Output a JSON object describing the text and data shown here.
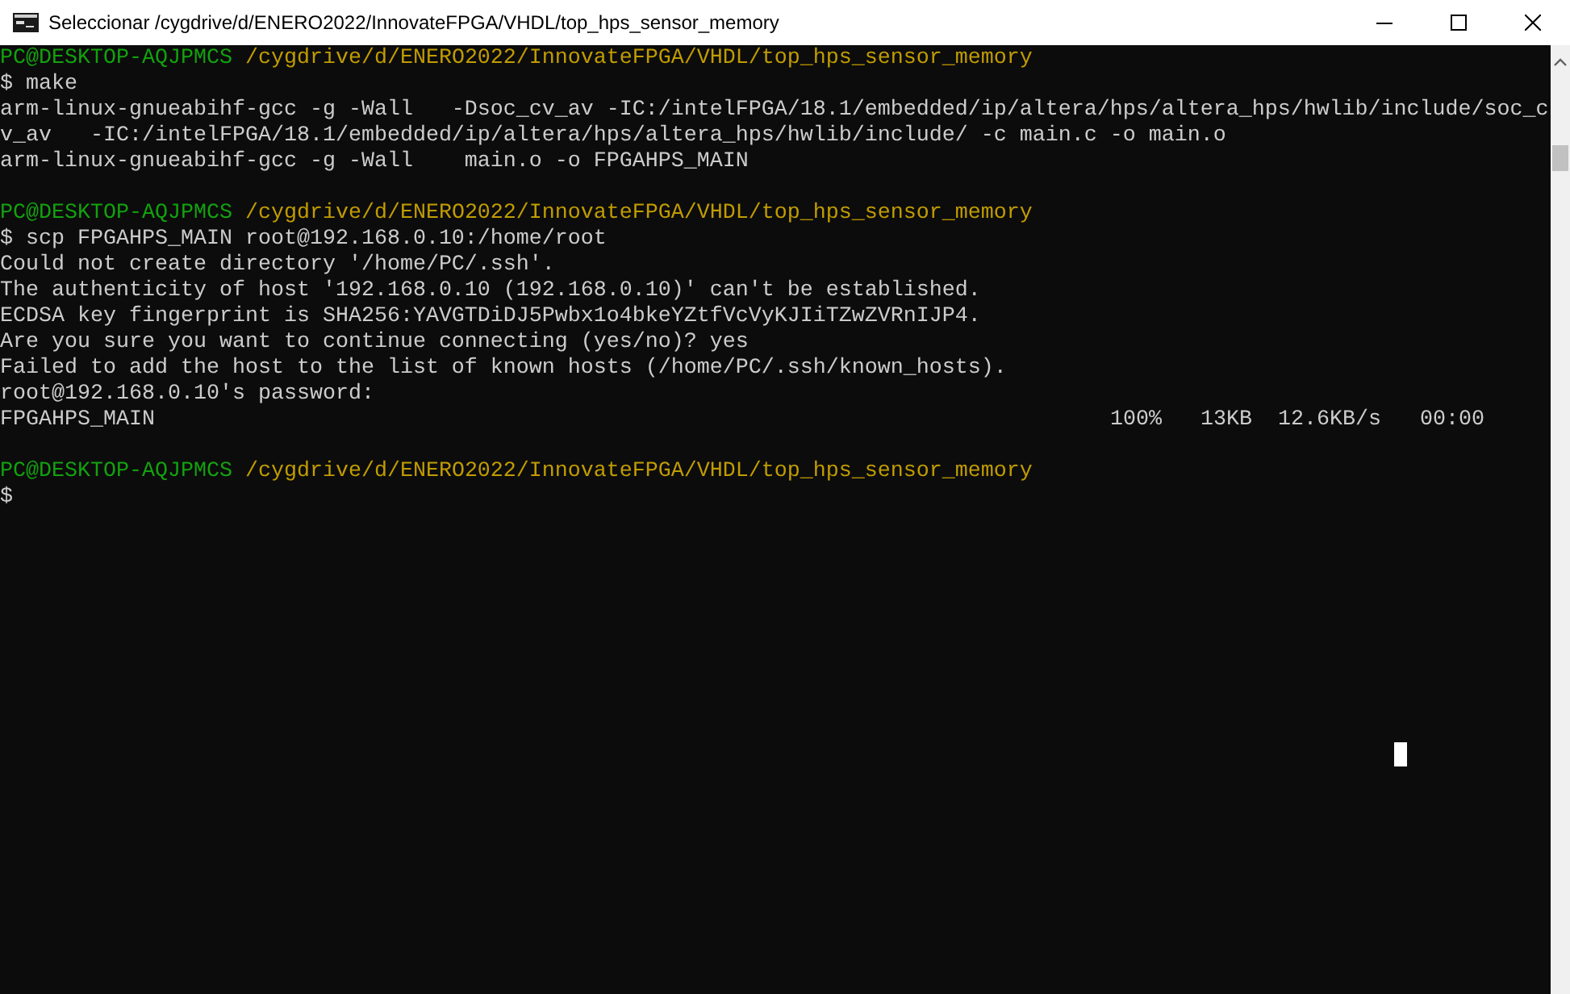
{
  "window": {
    "title": "Seleccionar /cygdrive/d/ENERO2022/InnovateFPGA/VHDL/top_hps_sensor_memory"
  },
  "terminal": {
    "lines": [
      {
        "kind": "prompt",
        "user": "PC@DESKTOP-AQJPMCS",
        "path": "/cygdrive/d/ENERO2022/InnovateFPGA/VHDL/top_hps_sensor_memory"
      },
      {
        "kind": "text",
        "text": "$ make"
      },
      {
        "kind": "text",
        "text": "arm-linux-gnueabihf-gcc -g -Wall   -Dsoc_cv_av -IC:/intelFPGA/18.1/embedded/ip/altera/hps/altera_hps/hwlib/include/soc_c"
      },
      {
        "kind": "text",
        "text": "v_av   -IC:/intelFPGA/18.1/embedded/ip/altera/hps/altera_hps/hwlib/include/ -c main.c -o main.o"
      },
      {
        "kind": "text",
        "text": "arm-linux-gnueabihf-gcc -g -Wall    main.o -o FPGAHPS_MAIN"
      },
      {
        "kind": "blank"
      },
      {
        "kind": "prompt",
        "user": "PC@DESKTOP-AQJPMCS",
        "path": "/cygdrive/d/ENERO2022/InnovateFPGA/VHDL/top_hps_sensor_memory"
      },
      {
        "kind": "text",
        "text": "$ scp FPGAHPS_MAIN root@192.168.0.10:/home/root"
      },
      {
        "kind": "text",
        "text": "Could not create directory '/home/PC/.ssh'."
      },
      {
        "kind": "text",
        "text": "The authenticity of host '192.168.0.10 (192.168.0.10)' can't be established."
      },
      {
        "kind": "text",
        "text": "ECDSA key fingerprint is SHA256:YAVGTDiDJ5Pwbx1o4bkeYZtfVcVyKJIiTZwZVRnIJP4."
      },
      {
        "kind": "text",
        "text": "Are you sure you want to continue connecting (yes/no)? yes"
      },
      {
        "kind": "text",
        "text": "Failed to add the host to the list of known hosts (/home/PC/.ssh/known_hosts)."
      },
      {
        "kind": "text",
        "text": "root@192.168.0.10's password:"
      },
      {
        "kind": "progress",
        "file": "FPGAHPS_MAIN",
        "percent": "100%",
        "size": "13KB",
        "rate": "12.6KB/s",
        "time": "00:00"
      },
      {
        "kind": "blank"
      },
      {
        "kind": "prompt",
        "user": "PC@DESKTOP-AQJPMCS",
        "path": "/cygdrive/d/ENERO2022/InnovateFPGA/VHDL/top_hps_sensor_memory"
      },
      {
        "kind": "text",
        "text": "$"
      }
    ]
  }
}
